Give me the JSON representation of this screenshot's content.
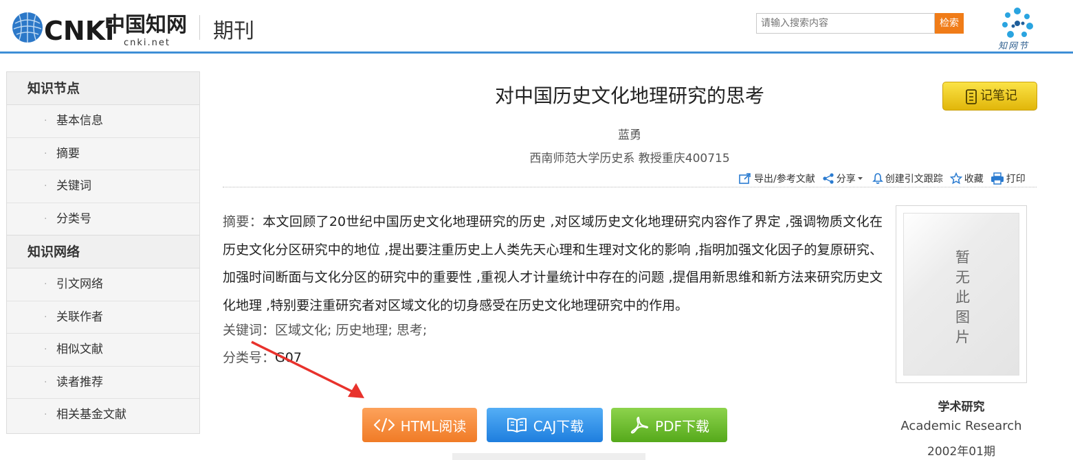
{
  "header": {
    "logo_text": "CNKi",
    "logo_cn": "中国知网",
    "logo_domain": "cnki.net",
    "channel": "期刊",
    "search_placeholder": "请输入搜索内容",
    "search_button": "检索",
    "zwj_label": "知网节"
  },
  "sidebar": {
    "sections": [
      {
        "title": "知识节点",
        "items": [
          "基本信息",
          "摘要",
          "关键词",
          "分类号"
        ]
      },
      {
        "title": "知识网络",
        "items": [
          "引文网络",
          "关联作者",
          "相似文献",
          "读者推荐",
          "相关基金文献"
        ]
      }
    ]
  },
  "article": {
    "title": "对中国历史文化地理研究的思考",
    "note_button": "记笔记",
    "author": "蓝勇",
    "organization": "西南师范大学历史系 教授重庆400715",
    "abstract_label": "摘要：",
    "abstract": "本文回顾了20世纪中国历史文化地理研究的历史 ,对区域历史文化地理研究内容作了界定 ,强调物质文化在历史文化分区研究中的地位 ,提出要注重历史上人类先天心理和生理对文化的影响 ,指明加强文化因子的复原研究、加强时间断面与文化分区的研究中的重要性 ,重视人才计量统计中存在的问题 ,提倡用新思维和新方法来研究历史文化地理 ,特别要注重研究者对区域文化的切身感受在历史文化地理研究中的作用。",
    "keywords_label": "关键词：",
    "keywords": [
      "区域文化;",
      "历史地理;",
      "思考;"
    ],
    "class_label": "分类号：",
    "class_value": "G07"
  },
  "toolbar": {
    "export": "导出/参考文献",
    "share": "分享",
    "track": "创建引文跟踪",
    "favorite": "收藏",
    "print": "打印"
  },
  "actions": {
    "html": "HTML阅读",
    "caj": "CAJ下载",
    "pdf": "PDF下载"
  },
  "cover": {
    "placeholder": "暂无此图片",
    "journal_cn": "学术研究",
    "journal_en": "Academic Research",
    "issue": "2002年01期"
  },
  "colors": {
    "brand_blue": "#3e8ed6",
    "search_orange": "#f07c18",
    "html_orange": "#f07b26",
    "caj_blue": "#1e7ede",
    "pdf_green": "#55a91b",
    "note_yellow": "#e1b60a",
    "arrow_red": "#e8322c"
  }
}
